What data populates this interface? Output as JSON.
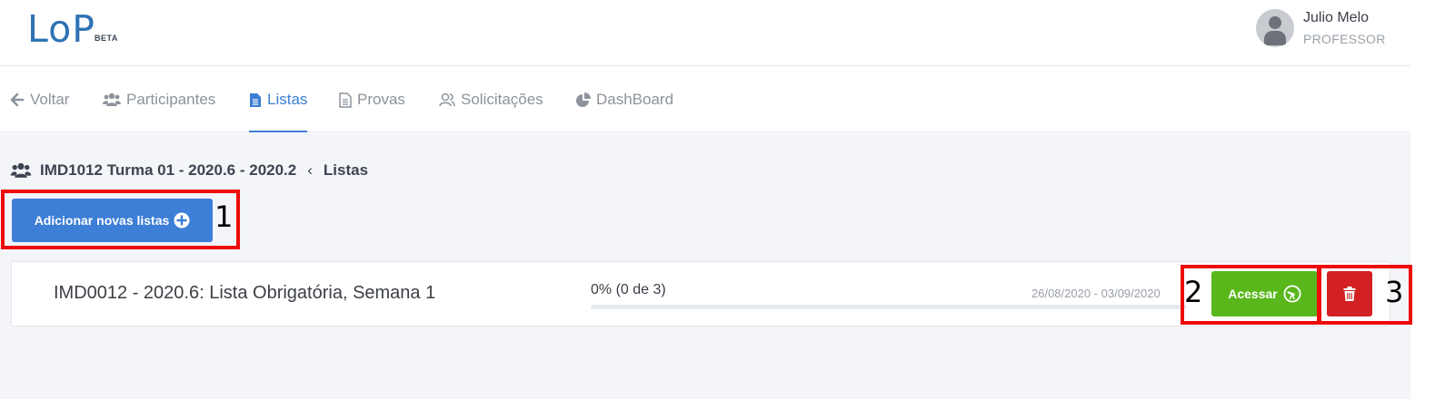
{
  "header": {
    "logo_text": "LoP",
    "logo_badge": "BETA",
    "user": {
      "name": "Julio Melo",
      "role": "PROFESSOR"
    }
  },
  "nav": {
    "items": [
      {
        "label": "Voltar",
        "icon": "arrow-left-icon"
      },
      {
        "label": "Participantes",
        "icon": "users-icon"
      },
      {
        "label": "Listas",
        "icon": "file-text-icon",
        "active": true
      },
      {
        "label": "Provas",
        "icon": "file-outline-icon"
      },
      {
        "label": "Solicitações",
        "icon": "user-outline-icon"
      },
      {
        "label": "DashBoard",
        "icon": "pie-chart-icon"
      }
    ]
  },
  "breadcrumb": {
    "icon": "users-icon",
    "course": "IMD1012 Turma 01 - 2020.6 - 2020.2",
    "separator": "‹",
    "current": "Listas"
  },
  "actions": {
    "add_label": "Adicionar novas listas"
  },
  "lists": [
    {
      "title": "IMD0012 - 2020.6: Lista Obrigatória, Semana 1",
      "progress_text": "0% (0 de 3)",
      "progress_fraction": 0.0,
      "dates": "26/08/2020 - 03/09/2020",
      "access_label": "Acessar",
      "delete_icon": "trash-icon"
    }
  ],
  "annotations": [
    "1",
    "2",
    "3"
  ],
  "colors": {
    "brand_blue": "#3d7ed6",
    "logo_blue": "#2e73b4",
    "success_green": "#59b71b",
    "danger_red": "#d32022",
    "annotation_red": "#ee0a0a"
  }
}
